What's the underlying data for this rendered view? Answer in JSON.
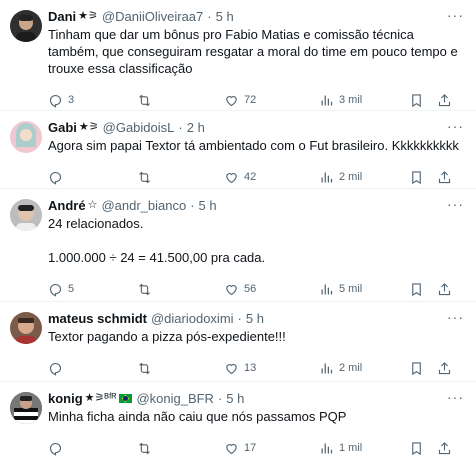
{
  "tweets": [
    {
      "name": "Dani",
      "badge": "★⚞",
      "handle": "@DaniiOliveiraa7",
      "time": "5 h",
      "text": "Tinham que dar um bônus pro Fabio Matias e comissão técnica também, que conseguiram resgatar a moral do time em pouco tempo e trouxe essa classificação",
      "replies": "3",
      "retweets": "",
      "likes": "72",
      "views": "3 mil",
      "avatar_color": "#3a3a3a"
    },
    {
      "name": "Gabi",
      "badge": "★⚞",
      "handle": "@GabidoisL",
      "time": "2 h",
      "text": "Agora sim papai Textor tá ambientado com o Fut brasileiro. Kkkkkkkkkk",
      "replies": "",
      "retweets": "",
      "likes": "42",
      "views": "2 mil",
      "avatar_color": "#e9a9b8"
    },
    {
      "name": "André",
      "badge": "☆",
      "handle": "@andr_bianco",
      "time": "5 h",
      "text": "24 relacionados.\n\n1.000.000 ÷ 24 = 41.500,00 pra cada.",
      "replies": "5",
      "retweets": "",
      "likes": "56",
      "views": "5 mil",
      "avatar_color": "#8a8a8a"
    },
    {
      "name": "mateus schmidt",
      "badge": "",
      "handle": "@diariodoximi",
      "time": "5 h",
      "text": "Textor pagando a pizza pós-expediente!!!",
      "replies": "",
      "retweets": "",
      "likes": "13",
      "views": "2 mil",
      "avatar_color": "#6b4a3a"
    },
    {
      "name": "konig",
      "badge": "★⚞ᴮᶠᴿ",
      "handle": "@konig_BFR",
      "time": "5 h",
      "text": "Minha ficha ainda não caiu que nós passamos PQP",
      "replies": "",
      "retweets": "",
      "likes": "17",
      "views": "1 mil",
      "avatar_color": "#555555"
    }
  ],
  "dot": "·",
  "more": "···"
}
